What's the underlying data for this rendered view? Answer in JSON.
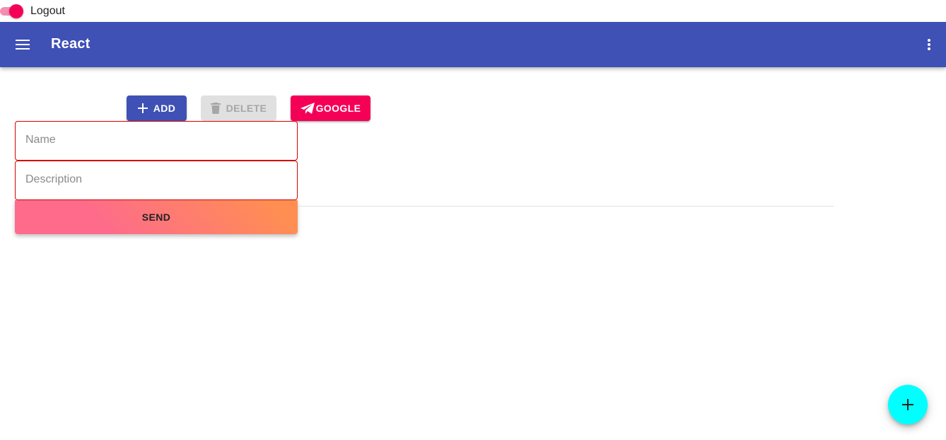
{
  "auth": {
    "toggle_label": "Logout",
    "toggle_on": true
  },
  "appbar": {
    "title": "React",
    "menu_icon": "menu-icon",
    "more_icon": "more-vert-icon"
  },
  "toolbar": {
    "add_label": "Add",
    "delete_label": "Delete",
    "google_label": "Google",
    "delete_disabled": true
  },
  "form": {
    "name_placeholder": "Name",
    "description_placeholder": "Description",
    "send_label": "SEND"
  },
  "fab": {
    "icon": "plus-icon"
  },
  "colors": {
    "primary": "#3f51b5",
    "secondary": "#f50057",
    "fab": "#00ffff",
    "error_border": "#d50000",
    "send_gradient": [
      "#fe6b8b",
      "#ff8e53"
    ]
  }
}
